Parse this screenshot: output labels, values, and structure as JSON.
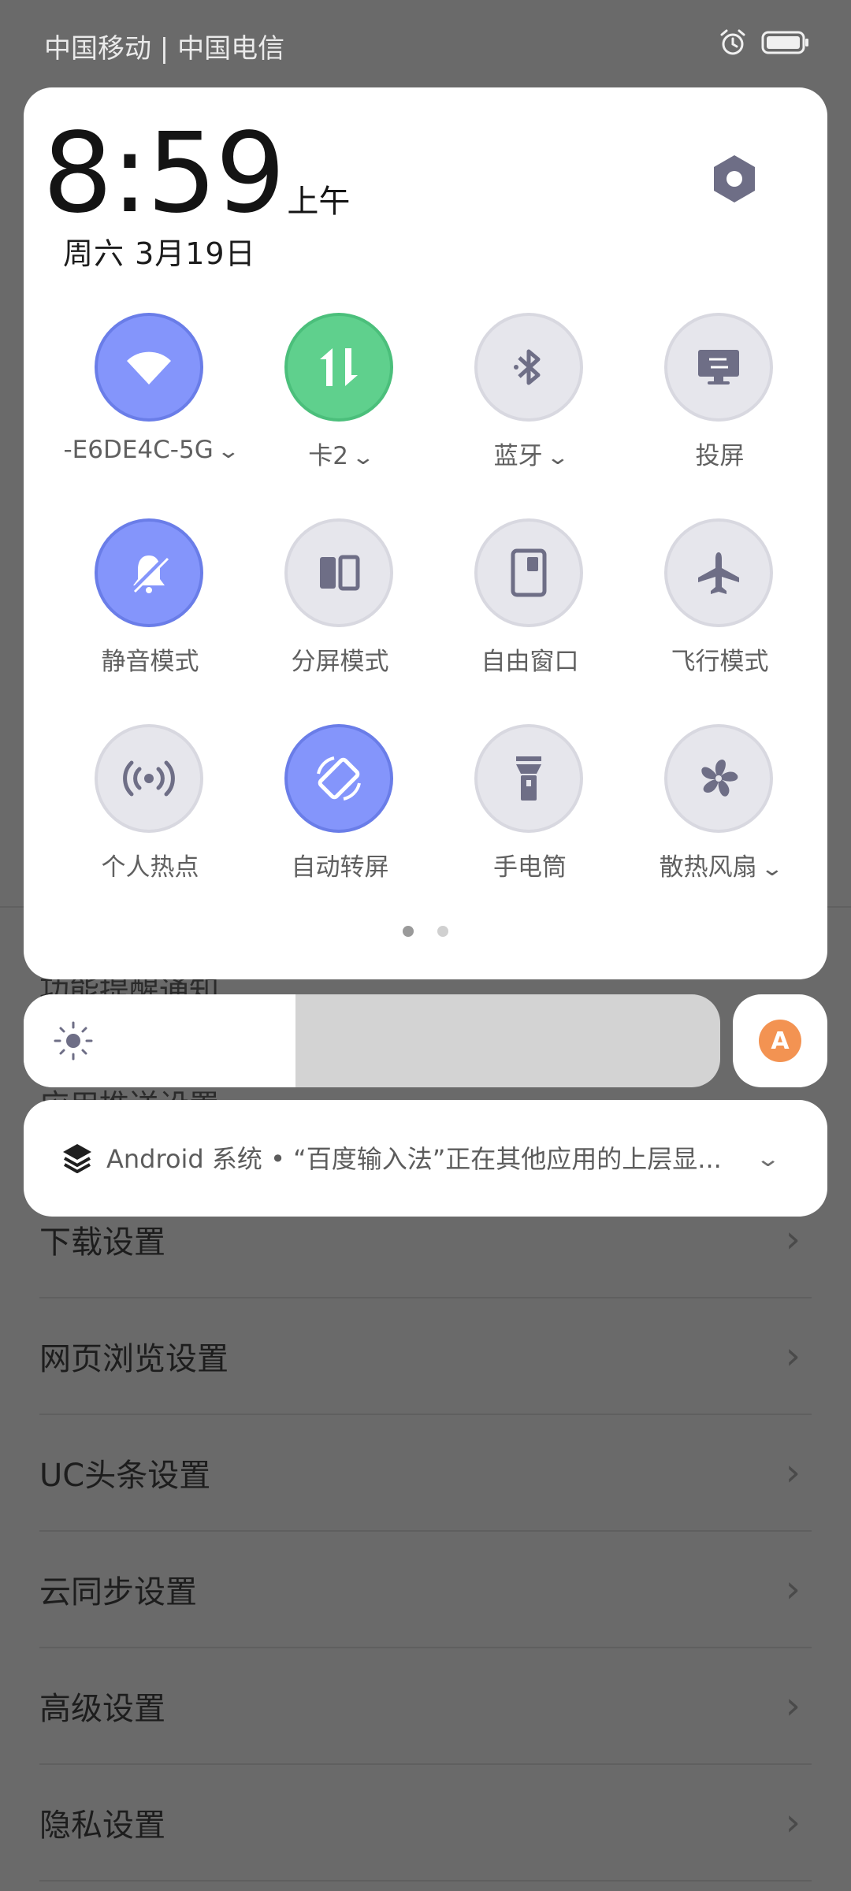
{
  "status_bar": {
    "carrier": "中国移动 | 中国电信",
    "icons": [
      "alarm-icon",
      "battery-icon"
    ]
  },
  "clock": {
    "time": "8:59",
    "ampm": "上午",
    "date": "周六  3月19日"
  },
  "tiles": [
    {
      "label": "-E6DE4C-5G",
      "dropdown": true,
      "icon": "wifi-icon",
      "state": "on-blue"
    },
    {
      "label": "卡2",
      "dropdown": true,
      "icon": "mobile-data-icon",
      "state": "on-green"
    },
    {
      "label": "蓝牙",
      "dropdown": true,
      "icon": "bluetooth-icon",
      "state": "off"
    },
    {
      "label": "投屏",
      "dropdown": false,
      "icon": "cast-icon",
      "state": "off"
    },
    {
      "label": "静音模式",
      "dropdown": false,
      "icon": "silent-icon",
      "state": "on-blue"
    },
    {
      "label": "分屏模式",
      "dropdown": false,
      "icon": "split-screen-icon",
      "state": "off"
    },
    {
      "label": "自由窗口",
      "dropdown": false,
      "icon": "free-window-icon",
      "state": "off"
    },
    {
      "label": "飞行模式",
      "dropdown": false,
      "icon": "airplane-icon",
      "state": "off"
    },
    {
      "label": "个人热点",
      "dropdown": false,
      "icon": "hotspot-icon",
      "state": "off"
    },
    {
      "label": "自动转屏",
      "dropdown": false,
      "icon": "auto-rotate-icon",
      "state": "on-blue"
    },
    {
      "label": "手电筒",
      "dropdown": false,
      "icon": "flashlight-icon",
      "state": "off"
    },
    {
      "label": "散热风扇",
      "dropdown": true,
      "icon": "fan-icon",
      "state": "off"
    }
  ],
  "pager": {
    "pages": 2,
    "current": 1
  },
  "brightness": {
    "level": 0.39,
    "auto_label": "A"
  },
  "notification": {
    "text": "Android 系统 • “百度输入法”正在其他应用的上层显..."
  },
  "background": {
    "partial_items": [
      "功能提醒通知",
      "应用推送设置"
    ],
    "settings_items": [
      "下载设置",
      "网页浏览设置",
      "UC头条设置",
      "云同步设置",
      "高级设置",
      "隐私设置"
    ]
  },
  "colors": {
    "accent_blue": "#8495fb",
    "accent_green": "#5fd08d",
    "tile_off": "#e6e6ec",
    "icon_gray": "#6e6e86",
    "auto_orange": "#f39352"
  }
}
